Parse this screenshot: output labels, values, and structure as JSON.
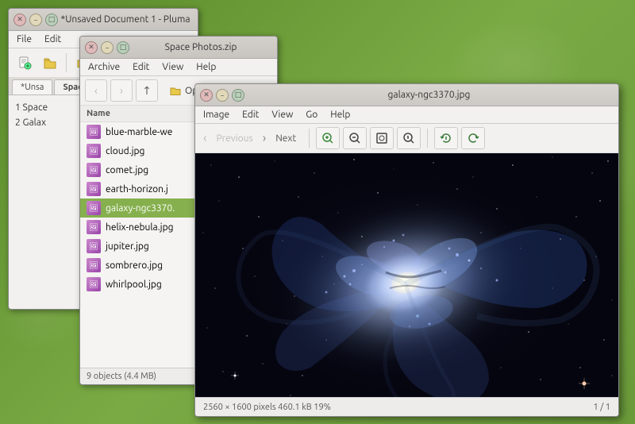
{
  "desktop": {
    "background_color": "#6a9a3a"
  },
  "pluma_window": {
    "title": "*Unsaved Document 1 - Pluma",
    "menu": [
      "File",
      "Edit"
    ],
    "tabs": [
      {
        "label": "*Unsa",
        "active": false
      },
      {
        "label": "Space",
        "active": false
      }
    ],
    "content_lines": [
      "1  Space",
      "2  Galax"
    ]
  },
  "filemanager_window": {
    "title": "Space Photos.zip",
    "menu": [
      "Archive",
      "Edit",
      "View",
      "Help"
    ],
    "toolbar_open_label": "Open",
    "file_header": "Name",
    "files": [
      {
        "name": "blue-marble-we",
        "selected": false
      },
      {
        "name": "cloud.jpg",
        "selected": false
      },
      {
        "name": "comet.jpg",
        "selected": false
      },
      {
        "name": "earth-horizon.j",
        "selected": false
      },
      {
        "name": "galaxy-ngc3370.",
        "selected": true
      },
      {
        "name": "helix-nebula.jpg",
        "selected": false
      },
      {
        "name": "jupiter.jpg",
        "selected": false
      },
      {
        "name": "sombrero.jpg",
        "selected": false
      },
      {
        "name": "whirlpool.jpg",
        "selected": false
      }
    ],
    "statusbar": "9 objects (4.4 MB)"
  },
  "imageviewer_window": {
    "title": "galaxy-ngc3370.jpg",
    "menu": [
      "Image",
      "Edit",
      "View",
      "Go",
      "Help"
    ],
    "nav_prev_label": "Previous",
    "nav_next_label": "Next",
    "zoom_in_label": "+",
    "zoom_out_label": "−",
    "zoom_fit_label": "⊡",
    "zoom_100_label": "⊞",
    "rotate_left_label": "↺",
    "rotate_right_label": "↻",
    "statusbar_left": "2560 × 1600 pixels  460.1 kB  19%",
    "statusbar_right": "1 / 1"
  }
}
